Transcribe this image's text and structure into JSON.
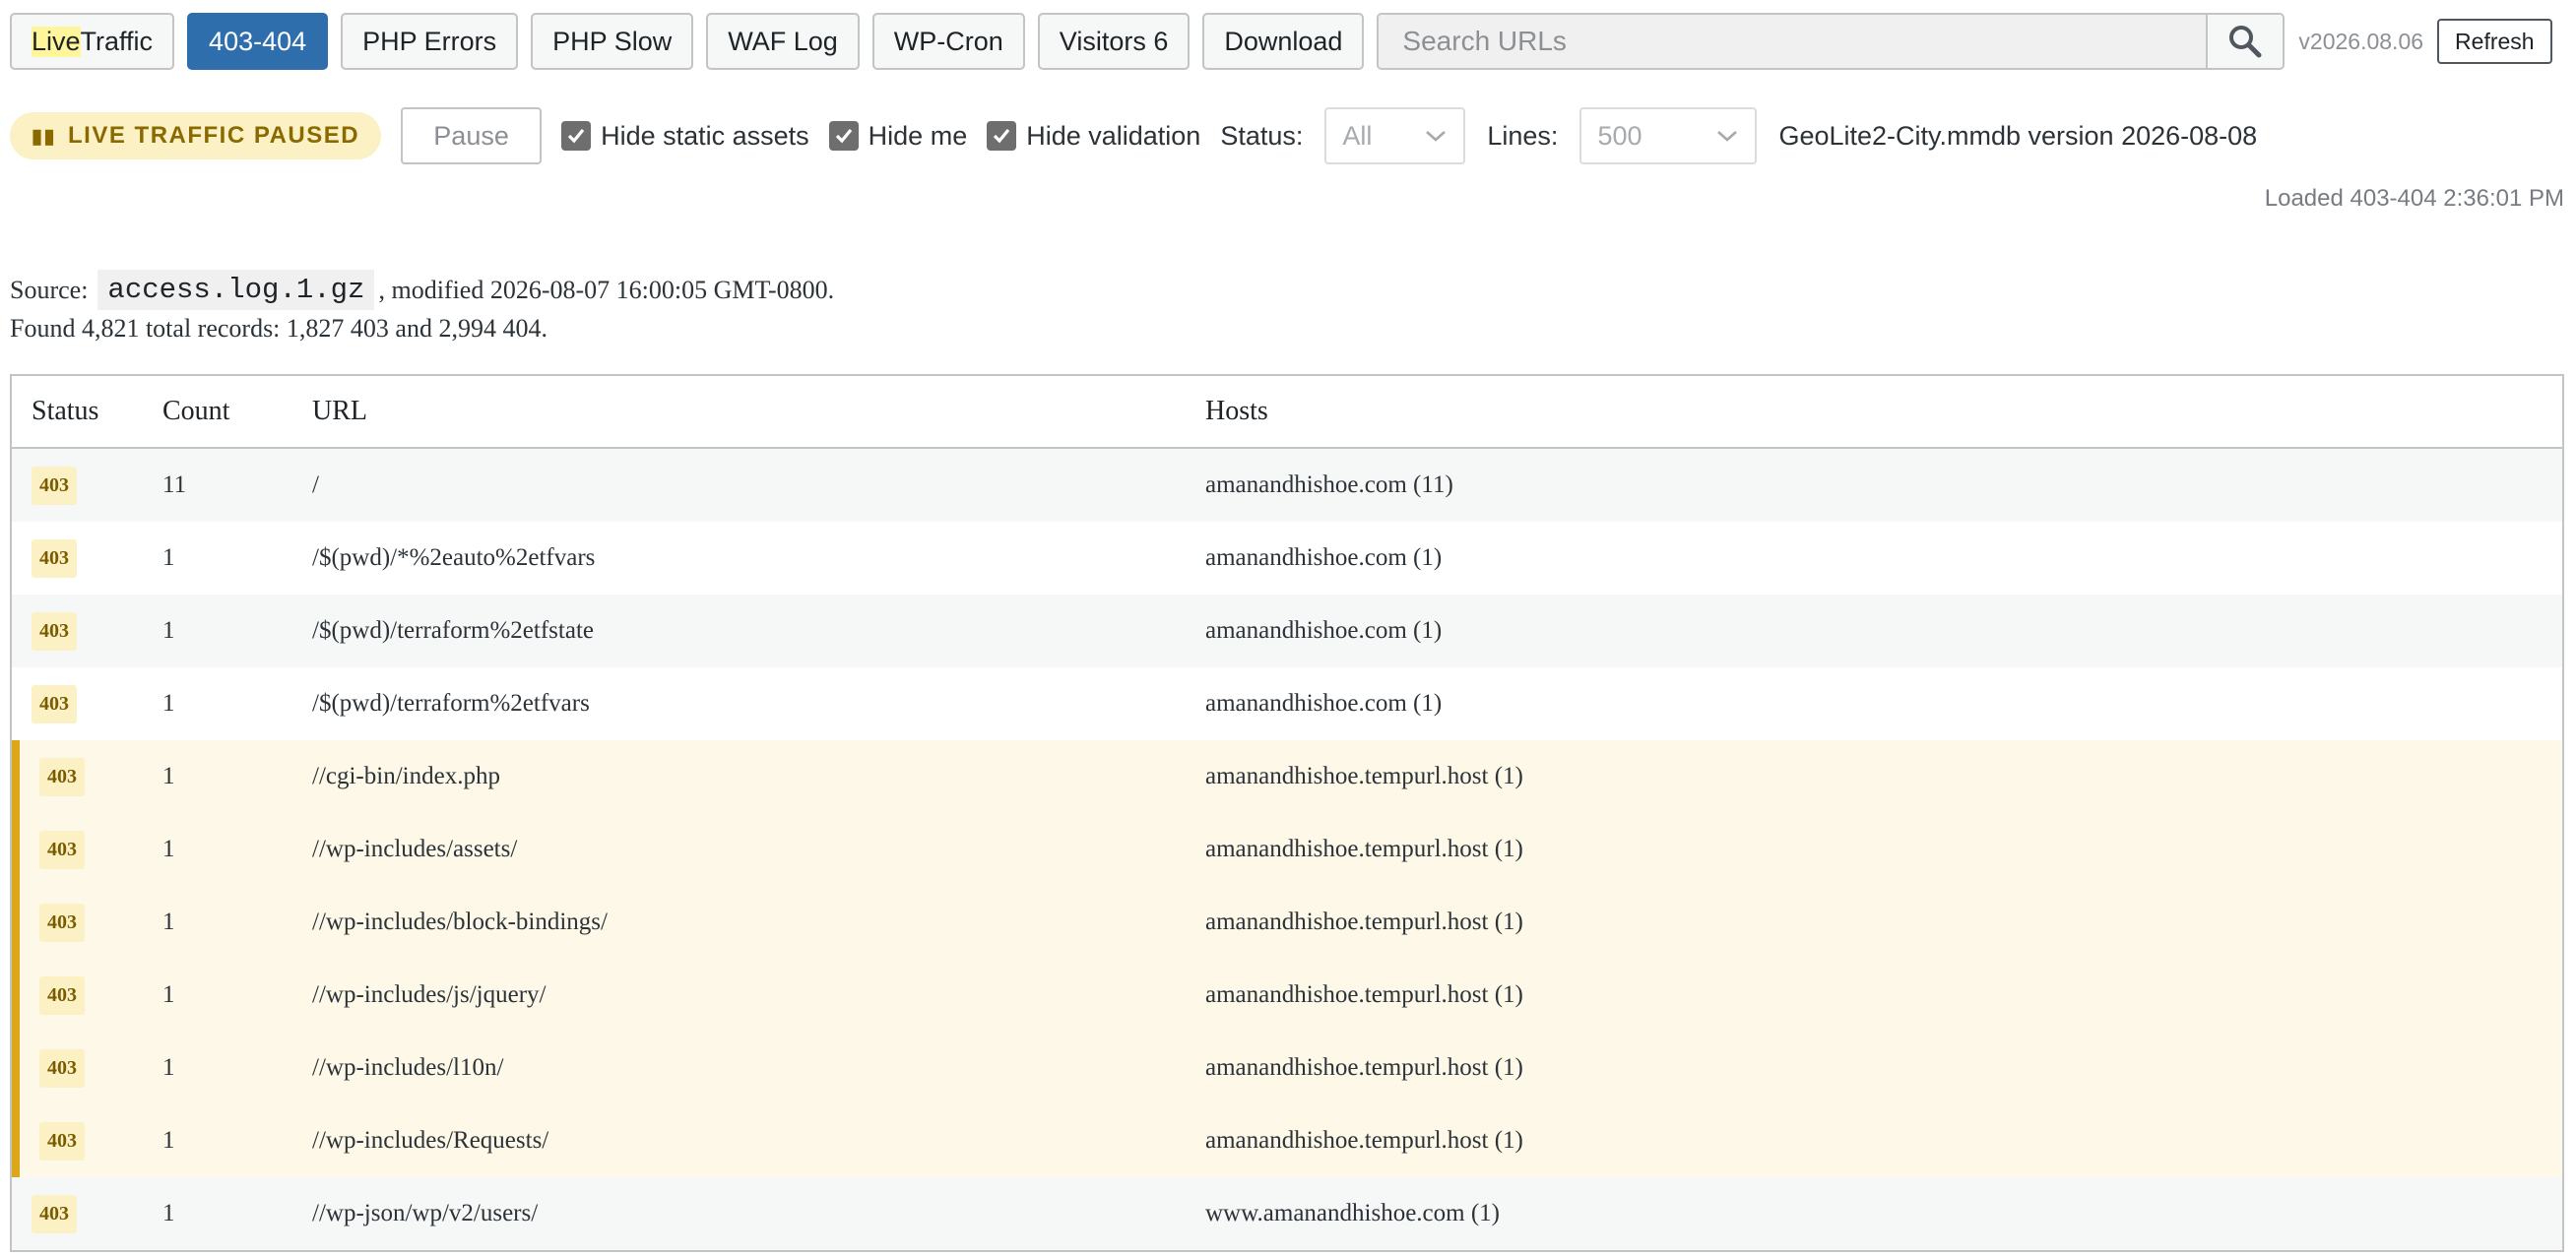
{
  "toolbar": {
    "tabs": [
      {
        "label_highlight": "Live",
        "label_rest": " Traffic"
      },
      {
        "label": "403-404",
        "active": true
      },
      {
        "label": "PHP Errors"
      },
      {
        "label": "PHP Slow"
      },
      {
        "label": "WAF Log"
      },
      {
        "label": "WP-Cron"
      },
      {
        "label": "Visitors 6"
      },
      {
        "label": "Download"
      }
    ],
    "search_placeholder": "Search URLs",
    "search_icon": "search-icon",
    "version": "v2026.08.06",
    "refresh_label": "Refresh"
  },
  "controls": {
    "paused_badge": "LIVE TRAFFIC PAUSED",
    "pause_label": "Pause",
    "checkboxes": [
      {
        "label": "Hide static assets",
        "checked": true
      },
      {
        "label": "Hide me",
        "checked": true
      },
      {
        "label": "Hide validation",
        "checked": true
      }
    ],
    "status_label": "Status:",
    "status_value": "All",
    "lines_label": "Lines:",
    "lines_value": "500",
    "geo_text": "GeoLite2-City.mmdb version 2026-08-08"
  },
  "loaded_text": "Loaded 403-404 2:36:01 PM",
  "source": {
    "prefix": "Source:",
    "file": "access.log.1.gz",
    "suffix": ", modified 2026-08-07 16:00:05 GMT-0800."
  },
  "found_text": "Found 4,821 total records: 1,827 403 and 2,994 404.",
  "table": {
    "headers": {
      "status": "Status",
      "count": "Count",
      "url": "URL",
      "hosts": "Hosts"
    },
    "rows": [
      {
        "status": "403",
        "count": "11",
        "url": "/",
        "hosts": "amanandhishoe.com (11)",
        "highlight": false
      },
      {
        "status": "403",
        "count": "1",
        "url": "/$(pwd)/*%2eauto%2etfvars",
        "hosts": "amanandhishoe.com (1)",
        "highlight": false
      },
      {
        "status": "403",
        "count": "1",
        "url": "/$(pwd)/terraform%2etfstate",
        "hosts": "amanandhishoe.com (1)",
        "highlight": false
      },
      {
        "status": "403",
        "count": "1",
        "url": "/$(pwd)/terraform%2etfvars",
        "hosts": "amanandhishoe.com (1)",
        "highlight": false
      },
      {
        "status": "403",
        "count": "1",
        "url": "//cgi-bin/index.php",
        "hosts": "amanandhishoe.tempurl.host (1)",
        "highlight": true
      },
      {
        "status": "403",
        "count": "1",
        "url": "//wp-includes/assets/",
        "hosts": "amanandhishoe.tempurl.host (1)",
        "highlight": true
      },
      {
        "status": "403",
        "count": "1",
        "url": "//wp-includes/block-bindings/",
        "hosts": "amanandhishoe.tempurl.host (1)",
        "highlight": true
      },
      {
        "status": "403",
        "count": "1",
        "url": "//wp-includes/js/jquery/",
        "hosts": "amanandhishoe.tempurl.host (1)",
        "highlight": true
      },
      {
        "status": "403",
        "count": "1",
        "url": "//wp-includes/l10n/",
        "hosts": "amanandhishoe.tempurl.host (1)",
        "highlight": true
      },
      {
        "status": "403",
        "count": "1",
        "url": "//wp-includes/Requests/",
        "hosts": "amanandhishoe.tempurl.host (1)",
        "highlight": true
      },
      {
        "status": "403",
        "count": "1",
        "url": "//wp-json/wp/v2/users/",
        "hosts": "www.amanandhishoe.com (1)",
        "highlight": false
      }
    ]
  },
  "colors": {
    "active_tab": "#2f6ead",
    "highlight_row": "#fdf8e7",
    "highlight_bar": "#dba617",
    "status_badge_bg": "#fcf1c4"
  }
}
